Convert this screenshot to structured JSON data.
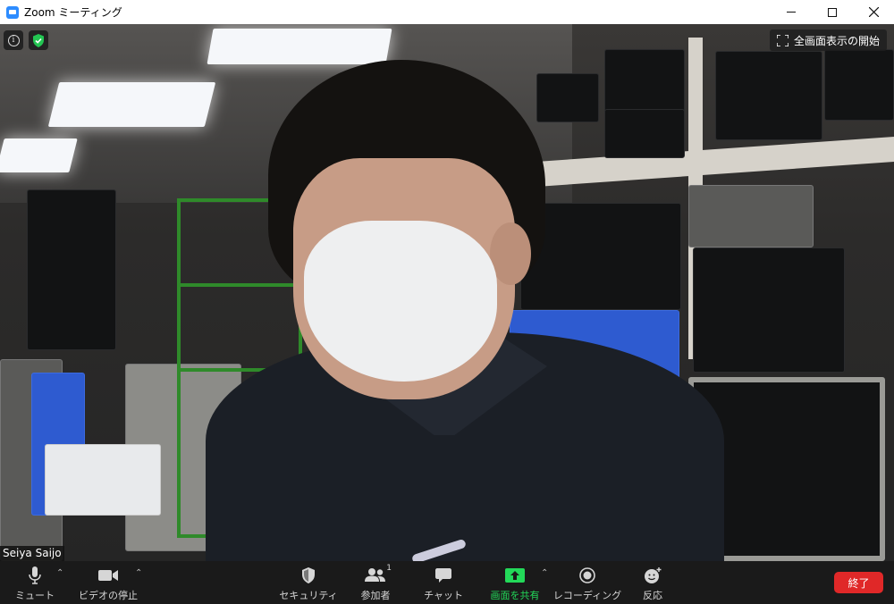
{
  "window": {
    "title": "Zoom ミーティング"
  },
  "overlay": {
    "fullscreen_label": "全画面表示の開始",
    "participant_name": "Seiya Saijo"
  },
  "toolbar": {
    "mute_label": "ミュート",
    "video_label": "ビデオの停止",
    "security_label": "セキュリティ",
    "participants_label": "参加者",
    "participants_count": "1",
    "chat_label": "チャット",
    "share_label": "画面を共有",
    "record_label": "レコーディング",
    "reactions_label": "反応",
    "end_label": "終了"
  },
  "colors": {
    "share_accent": "#23d959",
    "end_button": "#e02828",
    "zoom_blue": "#2d8cff"
  }
}
